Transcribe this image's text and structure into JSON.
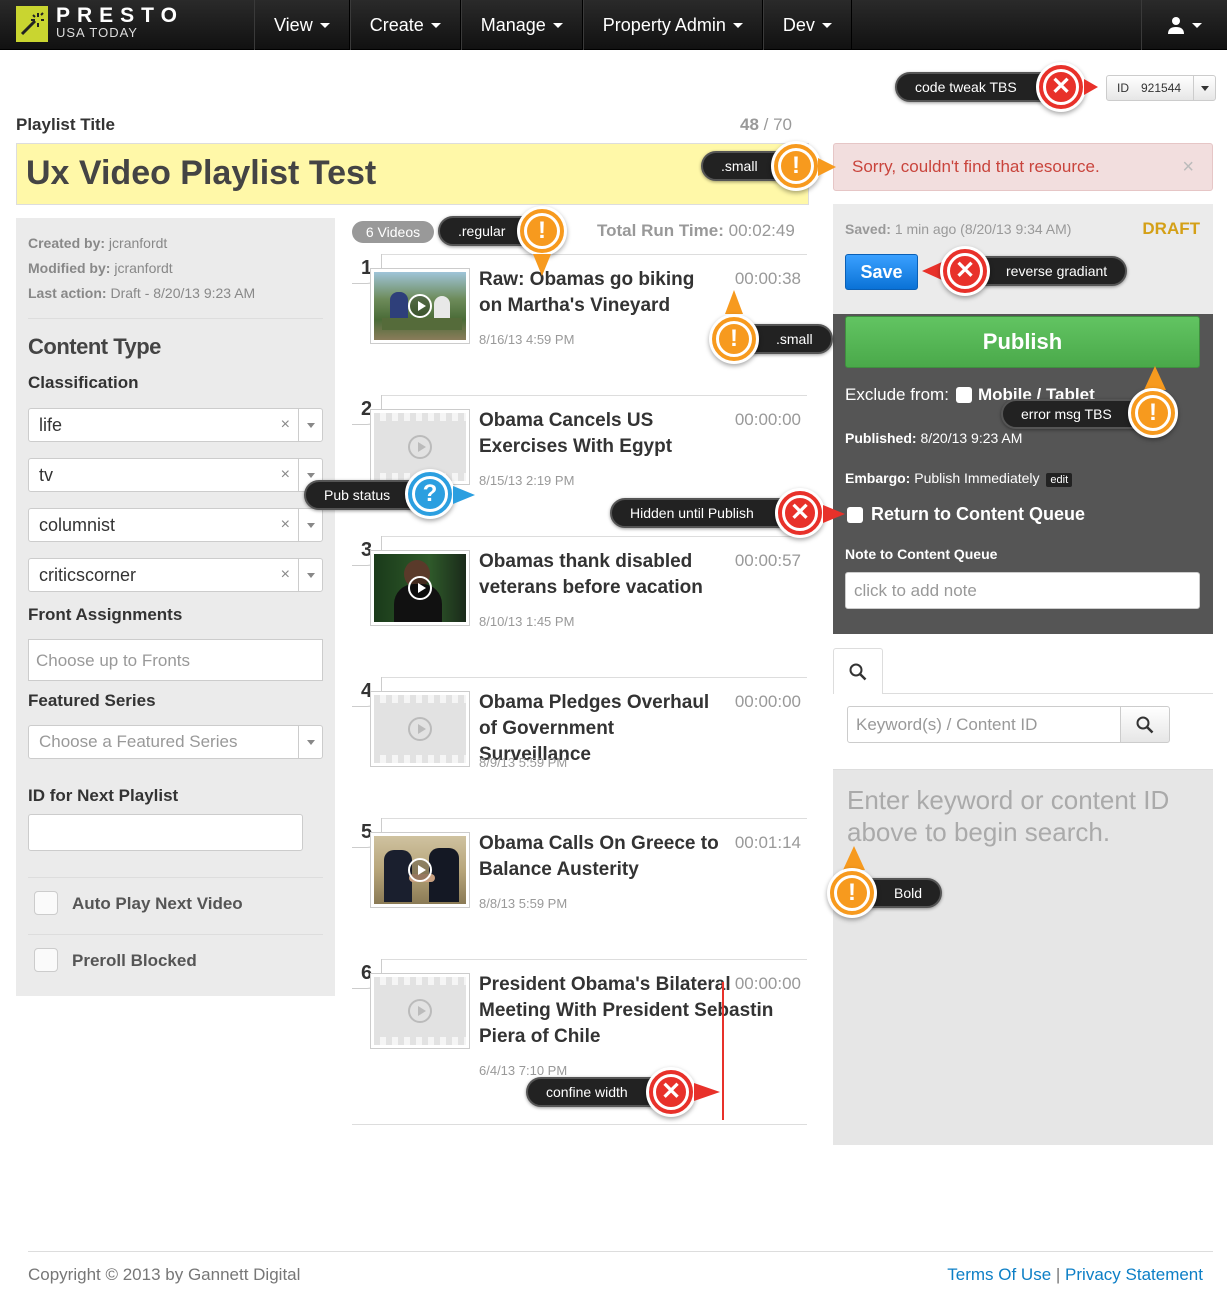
{
  "nav": {
    "brand_name": "PRESTO",
    "brand_sub": "USA TODAY",
    "items": [
      "View",
      "Create",
      "Manage",
      "Property Admin",
      "Dev"
    ]
  },
  "id_box": {
    "label": "ID",
    "value": "921544"
  },
  "playlist": {
    "title_label": "Playlist Title",
    "char_count": "48",
    "char_max": "/ 70",
    "title": "Ux Video Playlist Test"
  },
  "error_msg": {
    "text": "Sorry, couldn't find that resource.",
    "close": "×"
  },
  "meta": {
    "created_by_label": "Created by:",
    "created_by": "jcranfordt",
    "modified_by_label": "Modified by:",
    "modified_by": "jcranfordt",
    "last_action_label": "Last action:",
    "last_action": "Draft - 8/20/13 9:23 AM"
  },
  "left": {
    "content_type_heading": "Content Type",
    "classification_label": "Classification",
    "classifications": [
      "life",
      "tv",
      "columnist",
      "criticscorner"
    ],
    "clear_glyph": "×",
    "front_label": "Front Assignments",
    "front_placeholder": "Choose up to  Fronts",
    "series_label": "Featured Series",
    "series_placeholder": "Choose a Featured Series",
    "next_label": "ID for Next Playlist",
    "autoplay_label": "Auto Play Next Video",
    "preroll_label": "Preroll Blocked"
  },
  "videos_header": {
    "count": "6 Videos",
    "runtime_label": "Total Run Time:",
    "runtime": "00:02:49"
  },
  "videos": [
    {
      "num": "1",
      "title": "Raw: Obamas go biking on Martha's Vineyard",
      "date": "8/16/13 4:59 PM",
      "time": "00:00:38"
    },
    {
      "num": "2",
      "title": "Obama Cancels US Exercises With Egypt",
      "date": "8/15/13 2:19 PM",
      "time": "00:00:00"
    },
    {
      "num": "3",
      "title": "Obamas thank disabled veterans before vacation",
      "date": "8/10/13 1:45 PM",
      "time": "00:00:57"
    },
    {
      "num": "4",
      "title": "Obama Pledges Overhaul of Government Surveillance",
      "date": "8/9/13 5:59 PM",
      "time": "00:00:00"
    },
    {
      "num": "5",
      "title": "Obama Calls On Greece to Balance Austerity",
      "date": "8/8/13 5:59 PM",
      "time": "00:01:14"
    },
    {
      "num": "6",
      "title": "President Obama's Bilateral Meeting With President Sebastin Piera of Chile",
      "date": "6/4/13 7:10 PM",
      "time": "00:00:00"
    }
  ],
  "right": {
    "saved_label": "Saved:",
    "saved": "1 min ago (8/20/13 9:34 AM)",
    "status": "DRAFT",
    "save_btn": "Save",
    "publish_btn": "Publish",
    "exclude_label": "Exclude from:",
    "exclude_option": "Mobile / Tablet",
    "published_label": "Published:",
    "published": "8/20/13 9:23 AM",
    "embargo_label": "Embargo:",
    "embargo": "Publish Immediately",
    "embargo_edit": "edit",
    "return_label": "Return to Content Queue",
    "note_label": "Note to Content Queue",
    "note_placeholder": "click to add note"
  },
  "search": {
    "placeholder": "Keyword(s) / Content ID",
    "empty_text": "Enter keyword or content ID above to begin search."
  },
  "annotations": {
    "code_tweak": "code tweak TBS",
    "small1": ".small",
    "regular": ".regular",
    "small2": ".small",
    "reverse": "reverse gradiant",
    "error_tbs": "error msg TBS",
    "pub_status": "Pub status",
    "hidden": "Hidden until Publish",
    "bold": "Bold",
    "confine": "confine width"
  },
  "footer": {
    "copyright": "Copyright © 2013 by Gannett Digital",
    "terms": "Terms Of Use",
    "sep": "|",
    "privacy": "Privacy Statement"
  },
  "colors": {
    "error_red": "#e8312a",
    "warn_orange": "#f79a1e",
    "info_blue": "#2b9fe0",
    "draft": "#d4a017",
    "publish_green": "#5cb85c",
    "save_blue": "#0a72d6"
  }
}
